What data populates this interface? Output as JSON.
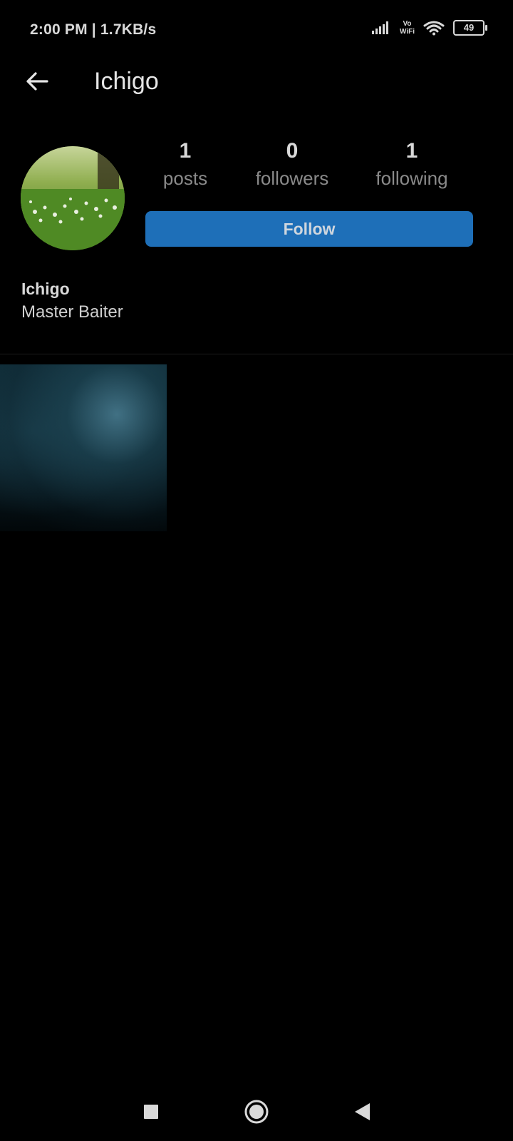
{
  "status_bar": {
    "time_speed": "2:00 PM | 1.7KB/s",
    "volte_top": "Vo",
    "volte_bottom": "WiFi",
    "battery": "49"
  },
  "header": {
    "title": "Ichigo"
  },
  "profile": {
    "stats": [
      {
        "count": "1",
        "label": "posts"
      },
      {
        "count": "0",
        "label": "followers"
      },
      {
        "count": "1",
        "label": "following"
      }
    ],
    "follow_label": "Follow",
    "name": "Ichigo",
    "bio": "Master Baiter"
  },
  "posts": {
    "count": 1
  },
  "colors": {
    "background": "#000000",
    "accent": "#1e6fb8",
    "muted_text": "#8a8a8a"
  }
}
